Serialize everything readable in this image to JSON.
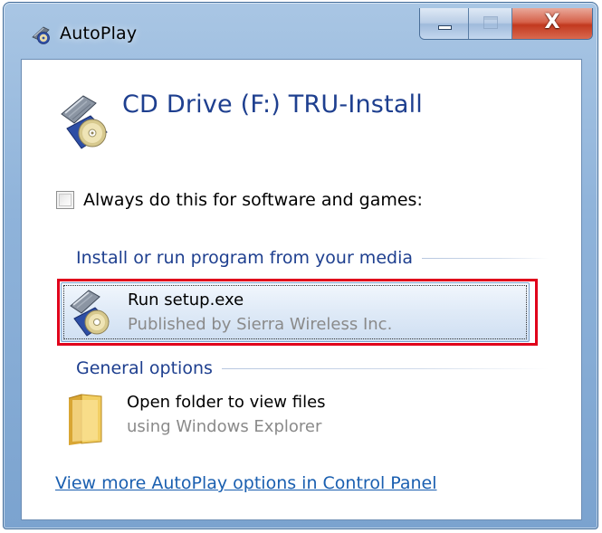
{
  "window": {
    "title": "AutoPlay",
    "icon": "autoplay-icon",
    "buttons": {
      "minimize": "minimize-button",
      "maximize": "maximize-button",
      "close_glyph": "X"
    }
  },
  "device": {
    "icon": "cd-drive-icon",
    "title": "CD Drive (F:) TRU-Install"
  },
  "always_checkbox": {
    "label": "Always do this for software and games:",
    "checked": false
  },
  "sections": [
    {
      "label": "Install or run program from your media",
      "options": [
        {
          "icon": "setup-cd-icon",
          "title": "Run setup.exe",
          "subtitle": "Published by Sierra Wireless Inc.",
          "selected": true
        }
      ]
    },
    {
      "label": "General options",
      "options": [
        {
          "icon": "folder-icon",
          "title": "Open folder to view files",
          "subtitle": "using Windows Explorer",
          "selected": false
        }
      ]
    }
  ],
  "footer_link": "View more AutoPlay options in Control Panel",
  "colors": {
    "accent_blue": "#1e3f8f",
    "link_blue": "#1a5fb0",
    "highlight_red": "#e0001b",
    "muted_gray": "#8a8a8a",
    "close_red": "#c2391f"
  }
}
